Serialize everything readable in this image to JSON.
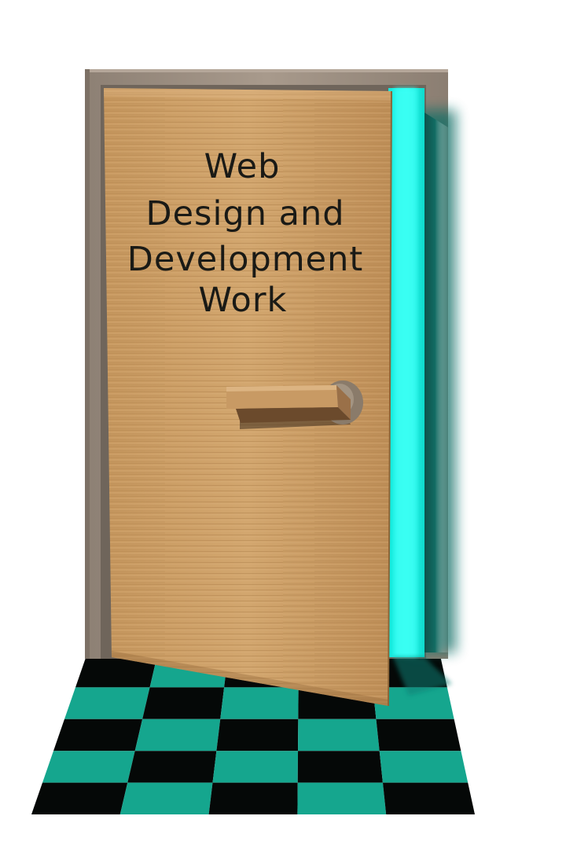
{
  "door": {
    "sign_lines": [
      "Web",
      "Design and",
      "Development",
      "Work"
    ]
  },
  "colors": {
    "background": "#ffffff",
    "door_wood": "#c89a62",
    "frame_wood": "#9b8d80",
    "glow": "#19ffee",
    "floor_teal": "#15a68e",
    "floor_black": "#050807",
    "handle": "#c4935c",
    "handle_rose": "#8a7b6a"
  },
  "icons": {
    "door": "door-icon",
    "handle": "door-handle-icon",
    "floor": "checkered-floor"
  }
}
